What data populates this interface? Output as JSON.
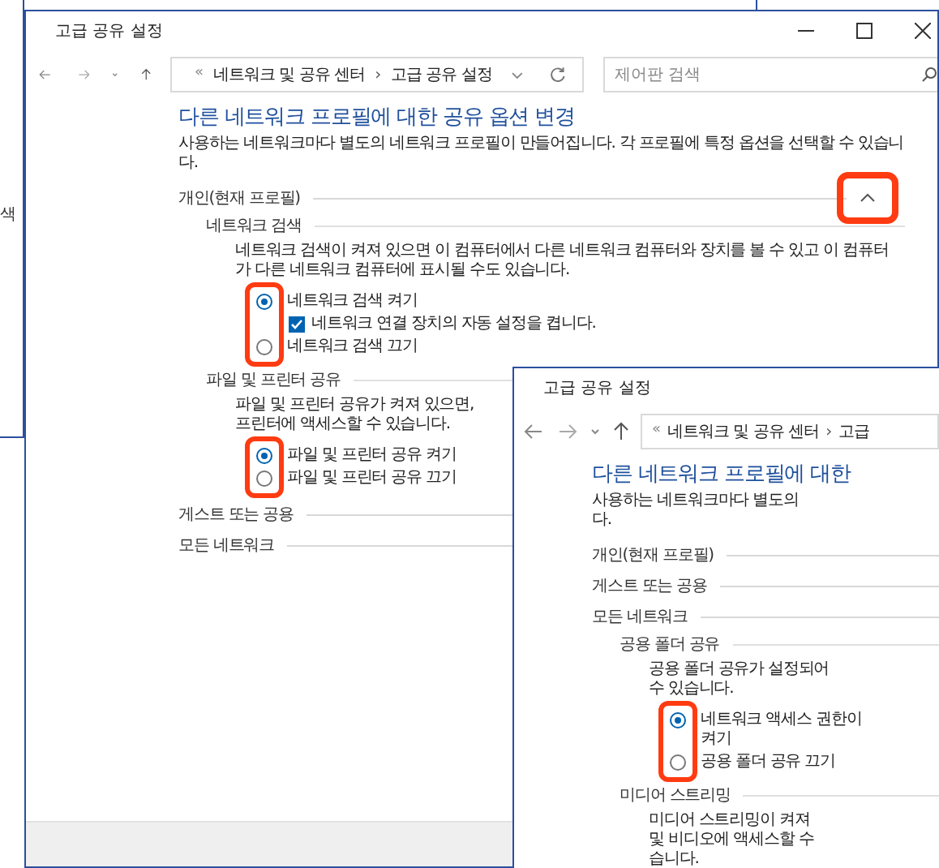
{
  "background_window": {
    "text": "색"
  },
  "windows": [
    {
      "title": "고급 공유 설정",
      "breadcrumb": {
        "prefix": "«",
        "separator": "›",
        "items": [
          "네트워크 및 공유 센터",
          "고급 공유 설정"
        ]
      },
      "search": {
        "placeholder": "제어판 검색"
      },
      "heading": "다른 네트워크 프로필에 대한 공유 옵션 변경",
      "description": [
        "사용하는 네트워크마다 별도의 네트워크 프로필이 만들어집니다. 각 프로필에 특정 옵션을 선택할 수 있습니",
        "다."
      ],
      "items": [
        {
          "kind": "profile",
          "label": "개인(현재 프로필)",
          "expanded": true
        },
        {
          "kind": "subsection",
          "label": "네트워크 검색"
        },
        {
          "kind": "paragraph",
          "lines": [
            "네트워크 검색이 켜져 있으면 이 컴퓨터에서 다른 네트워크 컴퓨터와 장치를 볼 수 있고 이 컴퓨터",
            "가 다른 네트워크 컴퓨터에 표시될 수도 있습니다."
          ]
        },
        {
          "kind": "radio",
          "lines": [
            "네트워크 검색 켜기"
          ],
          "selected": true
        },
        {
          "kind": "checkbox",
          "lines": [
            "네트워크 연결 장치의 자동 설정을 켭니다."
          ],
          "checked": true
        },
        {
          "kind": "radio",
          "lines": [
            "네트워크 검색 끄기"
          ],
          "selected": false
        },
        {
          "kind": "subsection",
          "label": "파일 및 프린터 공유"
        },
        {
          "kind": "paragraph",
          "lines": [
            "파일 및 프린터 공유가 켜져 있으면,",
            "프린터에 액세스할 수 있습니다."
          ]
        },
        {
          "kind": "radio",
          "lines": [
            "파일 및 프린터 공유 켜기"
          ],
          "selected": true
        },
        {
          "kind": "radio",
          "lines": [
            "파일 및 프린터 공유 끄기"
          ],
          "selected": false
        },
        {
          "kind": "profile",
          "label": "게스트 또는 공용"
        },
        {
          "kind": "profile",
          "label": "모든 네트워크"
        }
      ]
    },
    {
      "title": "고급 공유 설정",
      "breadcrumb": {
        "prefix": "«",
        "separator": "›",
        "items": [
          "네트워크 및 공유 센터",
          "고급"
        ]
      },
      "heading": "다른 네트워크 프로필에 대한",
      "description": [
        "사용하는 네트워크마다 별도의",
        "다."
      ],
      "items": [
        {
          "kind": "profile",
          "label": "개인(현재 프로필)"
        },
        {
          "kind": "profile",
          "label": "게스트 또는 공용"
        },
        {
          "kind": "profile",
          "label": "모든 네트워크"
        },
        {
          "kind": "subsection",
          "label": "공용 폴더 공유"
        },
        {
          "kind": "paragraph",
          "lines": [
            "공용 폴더 공유가 설정되어",
            "수 있습니다."
          ]
        },
        {
          "kind": "radio",
          "lines": [
            "네트워크 액세스 권한이",
            "켜기"
          ],
          "selected": true
        },
        {
          "kind": "radio",
          "lines": [
            "공용 폴더 공유 끄기"
          ],
          "selected": false
        },
        {
          "kind": "subsection",
          "label": "미디어 스트리밍"
        },
        {
          "kind": "paragraph",
          "lines": [
            "미디어 스트리밍이 켜져",
            "및 비디오에 액세스할 수",
            "습니다."
          ]
        }
      ]
    }
  ]
}
